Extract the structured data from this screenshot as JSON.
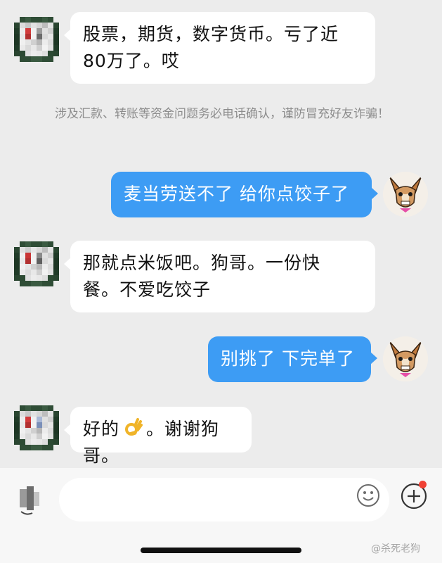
{
  "messages": [
    {
      "side": "left",
      "text_line1": "股票，期货，数字货币。亏了近",
      "text_line2": "80万了。哎"
    },
    {
      "side": "system",
      "text": "涉及汇款、转账等资金问题务必电话确认，谨防冒充好友诈骗！"
    },
    {
      "side": "right",
      "text": "麦当劳送不了 给你点饺子了"
    },
    {
      "side": "left",
      "text_line1": "那就点米饭吧。狗哥。一份快",
      "text_line2": "餐。不爱吃饺子"
    },
    {
      "side": "right",
      "text": "别挑了 下完单了"
    },
    {
      "side": "left",
      "text_before": "好的",
      "emoji": "ok-hand",
      "text_after": "。谢谢狗哥。"
    }
  ],
  "input": {
    "placeholder": ""
  },
  "icons": {
    "voice": "voice-icon",
    "emoji": "smiley-icon",
    "plus": "plus-icon"
  },
  "watermark": "@杀死老狗",
  "colors": {
    "background": "#ececec",
    "outgoing_bubble": "#3d9cf4",
    "incoming_bubble": "#ffffff",
    "notice_text": "#8c8c8c",
    "badge": "#f04135"
  }
}
